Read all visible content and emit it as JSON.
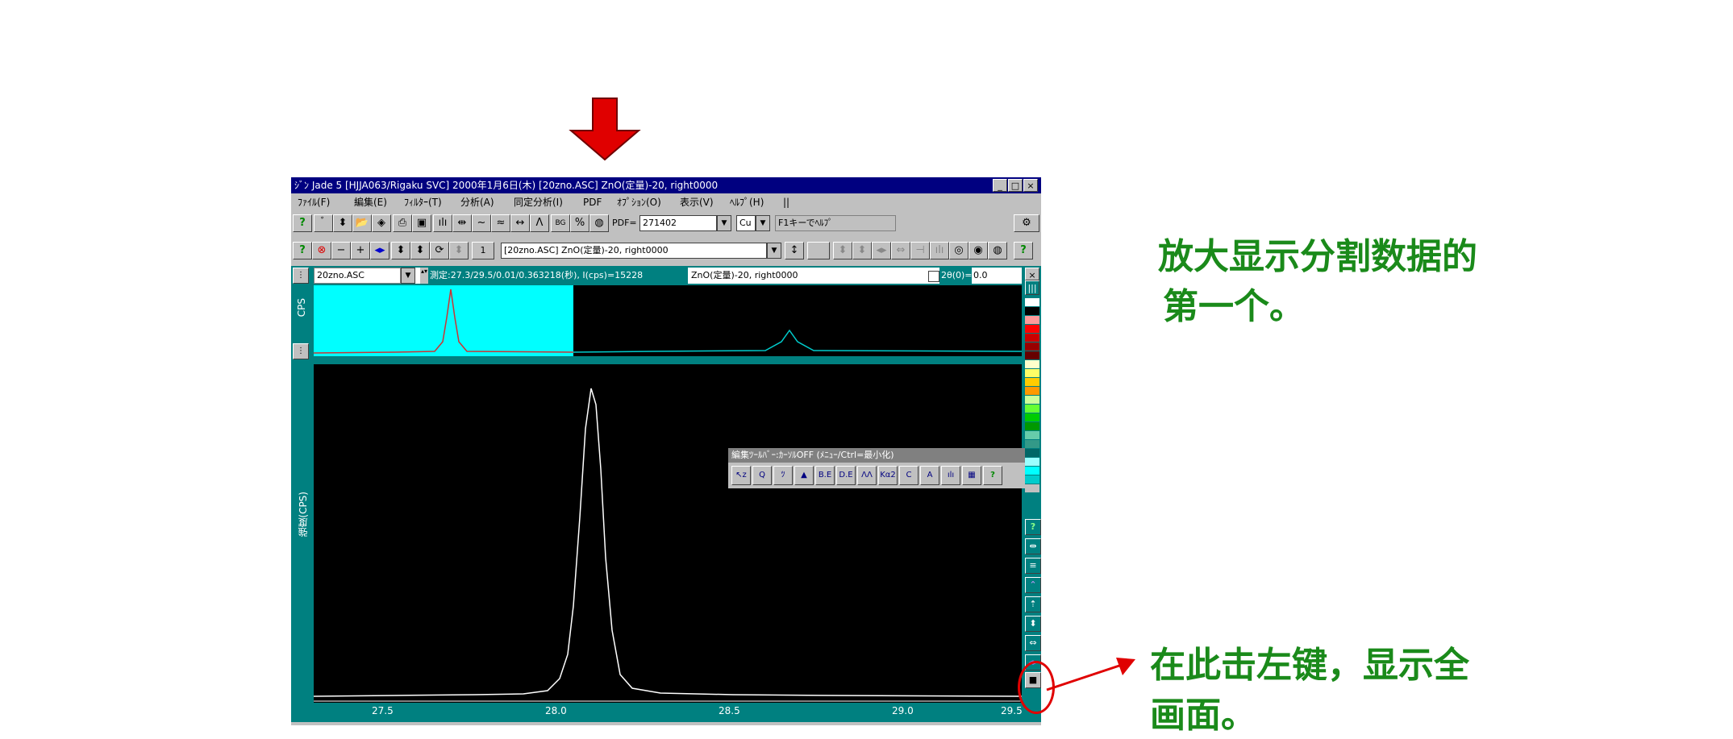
{
  "window": {
    "title": "ｼﾞﾝ Jade 5 [HJJA063/Rigaku SVC] 2000年1月6日(木) [20zno.ASC] ZnO(定量)-20, right0000",
    "controls": [
      "_",
      "□",
      "×"
    ]
  },
  "menu": [
    "ﾌｧｲﾙ(F)",
    "編集(E)",
    "ﾌｨﾙﾀｰ(T)",
    "分析(A)",
    "同定分析(I)",
    "PDF",
    "ｵﾌﾟｼｮﾝ(O)",
    "表示(V)",
    "ﾍﾙﾌﾟ(H)",
    "||"
  ],
  "toolbar1": {
    "pdf_label": "PDF=",
    "pdf_value": "271402",
    "target_value": "Cu",
    "help_hint": "F1キーでﾍﾙﾌﾟ"
  },
  "toolbar2": {
    "page_value": "1",
    "file_select": "[20zno.ASC] ZnO(定量)-20, right0000"
  },
  "infobar": {
    "file_name": "20zno.ASC",
    "measurement": "測定:27.3/29.5/0.01/0.363218(秒), I(cps)=15228",
    "sample": "ZnO(定量)-20, right0000",
    "twotheta_label": "2θ(0)=",
    "twotheta_value": "0.0"
  },
  "overview": {
    "ylabel": "CPS"
  },
  "main_plot": {
    "ylabel": "強度(CPS)",
    "x_ticks": [
      "27.5",
      "28.0",
      "28.5",
      "29.0",
      "29.5"
    ]
  },
  "edit_toolbar": {
    "title": "編集ﾂｰﾙﾊﾞｰ:ｶｰｿﾙOFF (ﾒﾆｭｰ/Ctrl=最小化)",
    "buttons": [
      "↖z",
      "Q",
      "ﾂ",
      "▲",
      "B.E",
      "D.E",
      "ΛΛ",
      "Kα2",
      "C",
      "A",
      "ılı",
      "▦",
      "?"
    ]
  },
  "annotations": {
    "top_line1": "放大显示分割数据的",
    "top_line2": "第一个。",
    "bottom_line1": "在此击左键，显示全",
    "bottom_line2": "画面。"
  },
  "colors": {
    "accent_red": "#e00000",
    "note_green": "#1a8a1a",
    "teal": "#008080",
    "title_blue": "#000080",
    "overview_cyan": "#00ffff"
  }
}
